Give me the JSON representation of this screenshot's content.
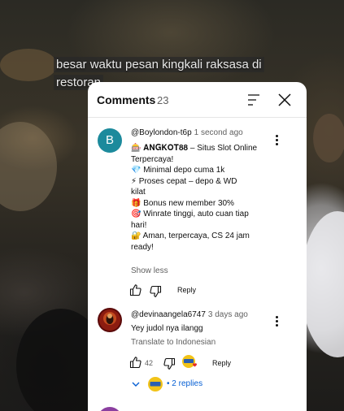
{
  "video": {
    "caption": "besar waktu pesan kingkali raksasa di restoran"
  },
  "comments_panel": {
    "title": "Comments",
    "count": "23",
    "sort_icon": "sort-icon",
    "close_icon": "close-icon"
  },
  "comments": [
    {
      "avatar_letter": "B",
      "avatar_color": "#1c8a9c",
      "handle": "@Boylondon-t6p",
      "time": "1 second ago",
      "lines": [
        "🎰 𝐀𝐍𝐆𝐊𝐎𝐓𝟖𝟖 – Situs Slot Online",
        "Terpercaya!",
        "💎 Minimal depo cuma 1k",
        "⚡ Proses cepat – depo & WD",
        "kilat",
        "🎁 Bonus new member 30%",
        "🎯 Winrate tinggi, auto cuan tiap",
        "hari!",
        "🔐 Aman, terpercaya, CS 24 jam",
        "ready!"
      ],
      "show_less": "Show less",
      "like_count": "",
      "reply_label": "Reply"
    },
    {
      "handle": "@devinaangela6747",
      "time": "3 days ago",
      "text": "Yey judol nya ilangg",
      "translate": "Translate to Indonesian",
      "like_count": "42",
      "reply_label": "Reply",
      "replies_label": "2 replies"
    }
  ],
  "colors": {
    "link": "#065fd4",
    "secondary_text": "#606060"
  }
}
